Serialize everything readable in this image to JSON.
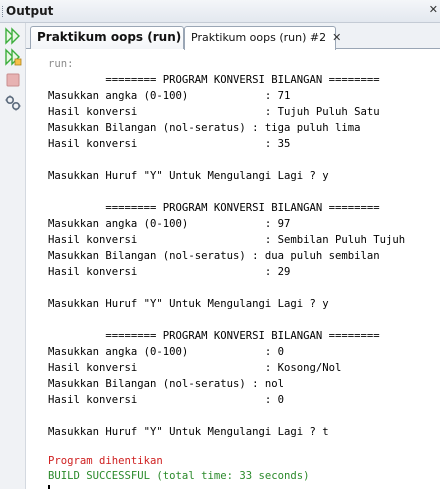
{
  "window": {
    "title": "Output"
  },
  "tabs": [
    {
      "label": "Praktikum oops (run)"
    },
    {
      "label": "Praktikum oops (run) #2"
    }
  ],
  "console": {
    "lines": [
      "run:",
      "         ======== PROGRAM KONVERSI BILANGAN ========",
      "Masukkan angka (0-100)            : 71",
      "Hasil konversi                    : Tujuh Puluh Satu",
      "Masukkan Bilangan (nol-seratus) : tiga puluh lima",
      "Hasil konversi                    : 35",
      "",
      "Masukkan Huruf \"Y\" Untuk Mengulangi Lagi ? y",
      "",
      "         ======== PROGRAM KONVERSI BILANGAN ========",
      "Masukkan angka (0-100)            : 97",
      "Hasil konversi                    : Sembilan Puluh Tujuh",
      "Masukkan Bilangan (nol-seratus) : dua puluh sembilan",
      "Hasil konversi                    : 29",
      "",
      "Masukkan Huruf \"Y\" Untuk Mengulangi Lagi ? y",
      "",
      "         ======== PROGRAM KONVERSI BILANGAN ========",
      "Masukkan angka (0-100)            : 0",
      "Hasil konversi                    : Kosong/Nol",
      "Masukkan Bilangan (nol-seratus) : nol",
      "Hasil konversi                    : 0",
      "",
      "Masukkan Huruf \"Y\" Untuk Mengulangi Lagi ? t",
      "",
      "Program dihentikan",
      "BUILD SUCCESSFUL (total time: 33 seconds)"
    ]
  },
  "colors": {
    "run_label": "#8c8c8c",
    "stopped": "#cf1f1f",
    "build_success": "#2b8a2b",
    "rerun_icon": "#3cae3c"
  }
}
